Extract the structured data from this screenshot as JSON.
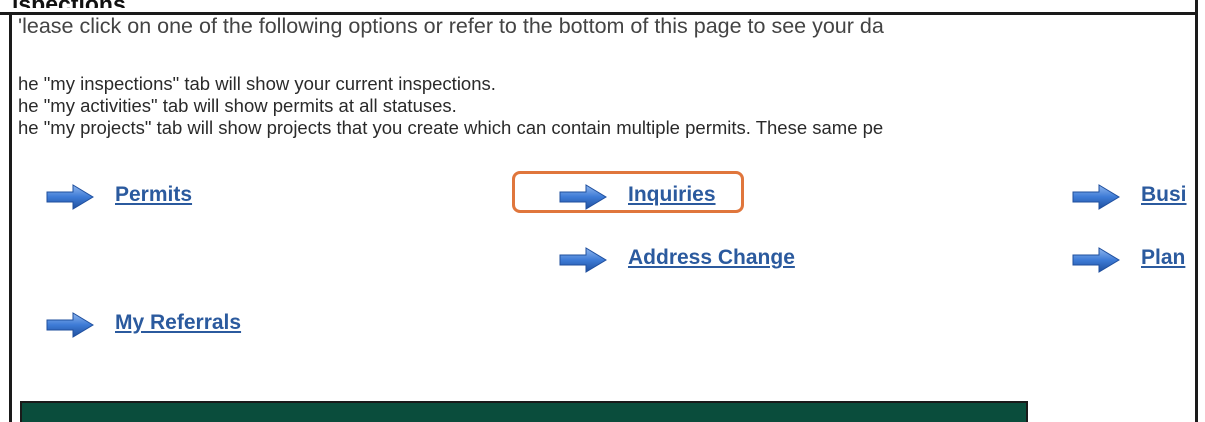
{
  "page": {
    "header_fragment": "ispections",
    "intro": "'lease click on one of the following options or refer to the bottom of this page to see your da",
    "info_lines": [
      "he \"my inspections\" tab will show your current inspections.",
      "he \"my activities\" tab will show permits at all statuses.",
      "he \"my projects\" tab will show projects that you create which can contain multiple permits. These same pe"
    ]
  },
  "links": {
    "permits": "Permits",
    "inquiries": "Inquiries",
    "address_change": "Address Change",
    "business": "Busi",
    "plan": "Plan",
    "my_referrals": "My Referrals"
  },
  "colors": {
    "link": "#2b5a9e",
    "highlight": "#e0763c",
    "banner": "#0a4d3c",
    "arrow": "#3d7bd6"
  }
}
